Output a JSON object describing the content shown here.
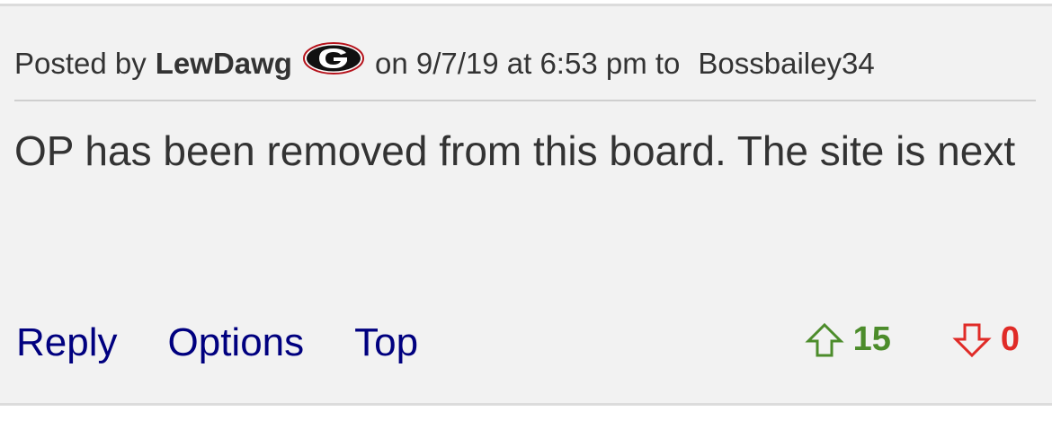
{
  "post": {
    "posted_by_prefix": "Posted by",
    "author": "LewDawg",
    "team_logo_icon": "georgia-g-logo-icon",
    "date_prefix": "on 9/7/19 at 6:53 pm to",
    "recipient": "Bossbailey34",
    "body": "OP has been removed from this board. The site is next"
  },
  "actions": {
    "reply": "Reply",
    "options": "Options",
    "top": "Top"
  },
  "votes": {
    "up_icon": "up-arrow-icon",
    "up_count": "15",
    "up_color": "#4c8c2b",
    "down_icon": "down-arrow-icon",
    "down_count": "0",
    "down_color": "#e02b27"
  },
  "colors": {
    "background": "#f2f2f2",
    "link": "#00007f",
    "text": "#333333"
  }
}
